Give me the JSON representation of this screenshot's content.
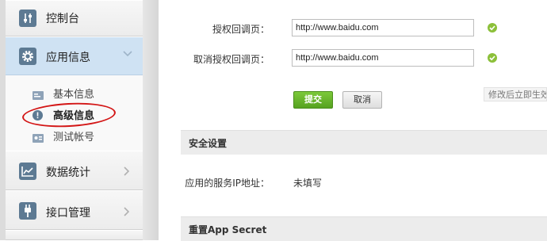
{
  "sidebar": {
    "items": [
      {
        "label": "控制台",
        "icon": "sliders-icon"
      },
      {
        "label": "应用信息",
        "icon": "gear-icon",
        "chevron": "chevron-down-icon"
      },
      {
        "label": "数据统计",
        "icon": "chart-icon",
        "chevron": "chevron-right-icon"
      },
      {
        "label": "接口管理",
        "icon": "plug-icon",
        "chevron": "chevron-right-icon"
      }
    ],
    "subitems": [
      {
        "label": "基本信息",
        "icon": "card-icon"
      },
      {
        "label": "高级信息",
        "icon": "info-icon"
      },
      {
        "label": "测试帐号",
        "icon": "id-card-icon"
      }
    ]
  },
  "form": {
    "auth_callback_label": "授权回调页：",
    "auth_callback_value": "http://www.baidu.com",
    "cancel_callback_label": "取消授权回调页：",
    "cancel_callback_value": "http://www.baidu.com",
    "submit_label": "提交",
    "cancel_label": "取消",
    "hint": "修改后立即生效"
  },
  "security": {
    "title": "安全设置",
    "ip_label": "应用的服务IP地址：",
    "ip_value": "未填写"
  },
  "reset": {
    "title": "重置App Secret"
  },
  "colors": {
    "accent_green": "#5aa823",
    "active_nav": "#cfe2f3",
    "highlight_circle": "#d31616"
  }
}
